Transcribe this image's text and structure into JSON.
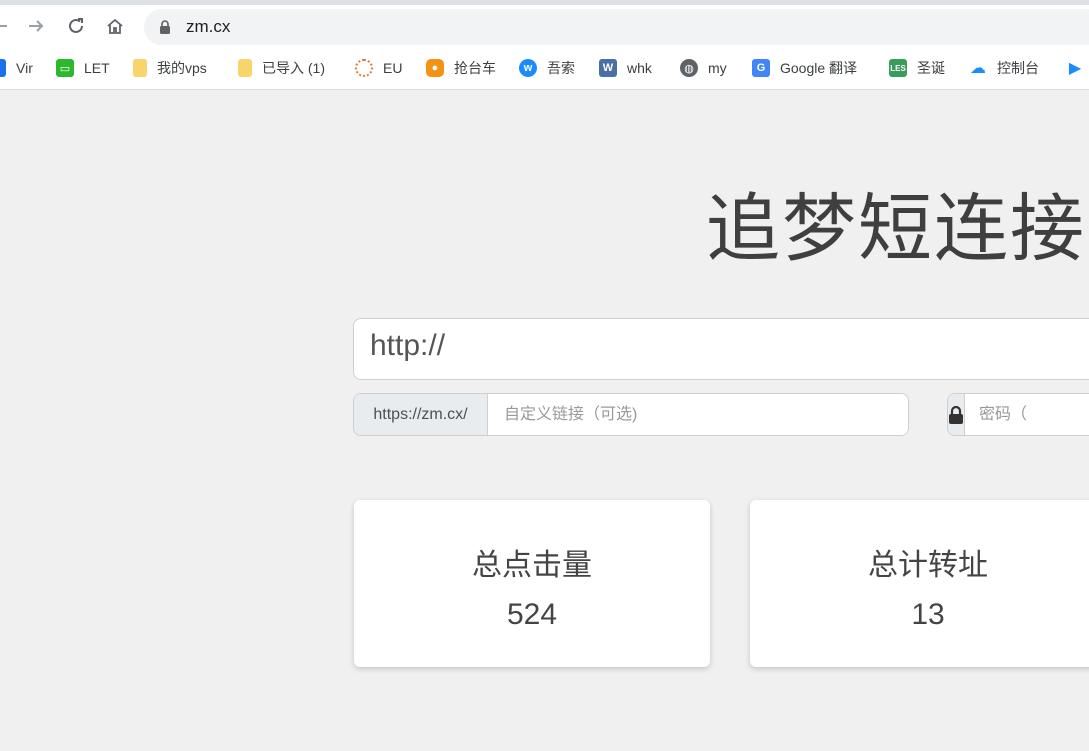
{
  "browser": {
    "address": "zm.cx",
    "nav": {
      "back_icon": "arrow-left-icon",
      "forward_icon": "arrow-right-icon",
      "reload_icon": "reload-icon",
      "home_icon": "home-icon"
    }
  },
  "bookmarks": [
    {
      "label": "Vir",
      "icon": "grid-icon",
      "color": "#1a73e8"
    },
    {
      "label": "LET",
      "icon": "monitor-icon",
      "color": "#2eb82e"
    },
    {
      "label": "我的vps",
      "icon": "folder-icon",
      "color": "#f7d56b"
    },
    {
      "label": "已导入 (1)",
      "icon": "folder-icon",
      "color": "#f7d56b"
    },
    {
      "label": "EU",
      "icon": "loading-icon",
      "color": "#e07b39"
    },
    {
      "label": "抢台车",
      "icon": "app-icon",
      "color": "#f29312"
    },
    {
      "label": "吾索",
      "icon": "w-circle-icon",
      "color": "#1a8cff"
    },
    {
      "label": "whk",
      "icon": "w-square-icon",
      "color": "#4a6fa5"
    },
    {
      "label": "my",
      "icon": "globe-icon",
      "color": "#5f6368"
    },
    {
      "label": "Google 翻译",
      "icon": "translate-icon",
      "color": "#4285f4"
    },
    {
      "label": "圣诞",
      "icon": "les-icon",
      "color": "#3a9c5a"
    },
    {
      "label": "控制台",
      "icon": "cloud-icon",
      "color": "#1a8cff"
    },
    {
      "label": "",
      "icon": "play-icon",
      "color": "#1a8cff"
    }
  ],
  "page": {
    "title": "追梦短连接",
    "url_placeholder": "http://",
    "prefix": "https://zm.cx/",
    "custom_placeholder": "自定义链接（可选)",
    "password_placeholder": "密码（",
    "lock_icon": "lock-icon"
  },
  "stats": [
    {
      "label": "总点击量",
      "value": "524"
    },
    {
      "label": "总计转址",
      "value": "13"
    }
  ]
}
